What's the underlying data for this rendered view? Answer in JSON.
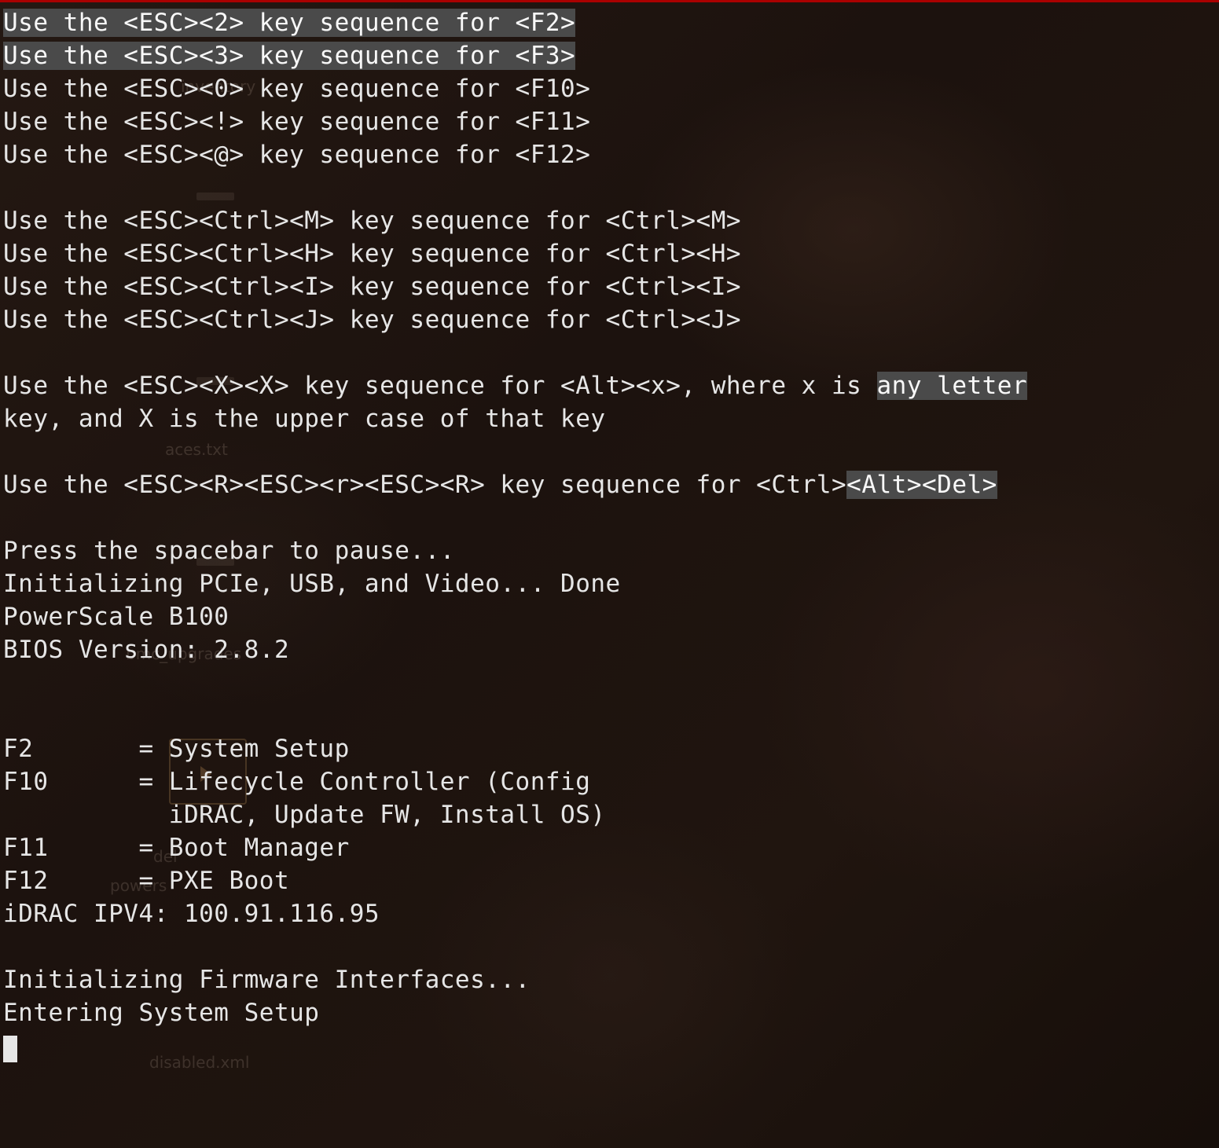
{
  "colors": {
    "text": "#e6e6e6",
    "highlight_bg": "#4a4a4a",
    "topbar": "#a00",
    "background": "#1a1210"
  },
  "desktop_ghosts": {
    "label1": "inventory",
    "label2": "aces.txt",
    "label3": "bmc_upgrades",
    "label4": "del",
    "label5": "powers",
    "label6": "disabled.xml"
  },
  "boot": {
    "esc_fn": [
      {
        "seq": "<ESC><2>",
        "target": "<F2>",
        "highlight": true
      },
      {
        "seq": "<ESC><3>",
        "target": "<F3>",
        "highlight": true
      },
      {
        "seq": "<ESC><0>",
        "target": "<F10>",
        "highlight": false
      },
      {
        "seq": "<ESC><!>",
        "target": "<F11>",
        "highlight": false
      },
      {
        "seq": "<ESC><@>",
        "target": "<F12>",
        "highlight": false
      }
    ],
    "esc_ctrl": [
      {
        "seq": "<ESC><Ctrl><M>",
        "target": "<Ctrl><M>"
      },
      {
        "seq": "<ESC><Ctrl><H>",
        "target": "<Ctrl><H>"
      },
      {
        "seq": "<ESC><Ctrl><I>",
        "target": "<Ctrl><I>"
      },
      {
        "seq": "<ESC><Ctrl><J>",
        "target": "<Ctrl><J>"
      }
    ],
    "altx_line1_a": "Use the <ESC><X><X> key sequence for <Alt><x>, where x is ",
    "altx_line1_b": "any letter",
    "altx_line2": "key, and X is the upper case of that key",
    "cad_a": "Use the <ESC><R><ESC><r><ESC><R> key sequence for <Ctrl>",
    "cad_b": "<Alt><Del>",
    "pause": "Press the spacebar to pause...",
    "init": "Initializing PCIe, USB, and Video... Done",
    "model": "PowerScale B100",
    "bios": "BIOS Version: 2.8.2",
    "menu": {
      "f2": "F2       = System Setup",
      "f10_a": "F10      = Lifecycle Controller (Config",
      "f10_b": "           iDRAC, Update FW, Install OS)",
      "f11": "F11      = Boot Manager",
      "f12": "F12      = PXE Boot",
      "idrac": "iDRAC IPV4: 100.91.116.95"
    },
    "fw": "Initializing Firmware Interfaces...",
    "enter": "Entering System Setup"
  }
}
